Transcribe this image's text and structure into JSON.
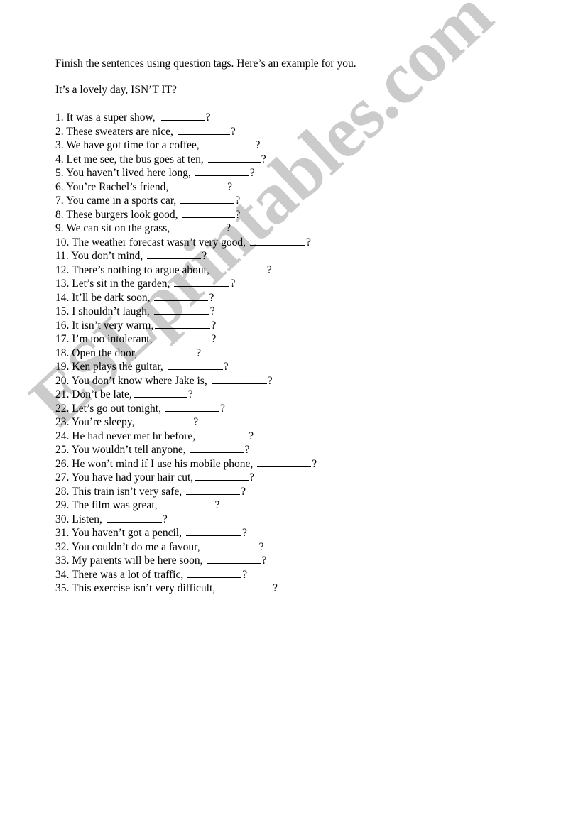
{
  "document": {
    "type": "worksheet",
    "intro": {
      "instruction": "Finish the sentences using question tags. Here’s an example for you.",
      "example": "It’s a lovely day, ISN’T IT?"
    },
    "watermark": {
      "text": "ESLprintables.com",
      "color": "#cbcbcb",
      "rotation_deg": -43
    },
    "question_mark": "?",
    "items": [
      {
        "num": "1.",
        "text": "It was a super show,",
        "gap": 6,
        "blank": 62,
        "tail": ""
      },
      {
        "num": "2.",
        "text": "These sweaters are nice,",
        "gap": 4,
        "blank": 74,
        "tail": ""
      },
      {
        "num": "3.",
        "text": "We have got time for a coffee,",
        "gap": 0,
        "blank": 76,
        "tail": ""
      },
      {
        "num": "4.",
        "text": "Let me see, the bus goes at ten,",
        "gap": 4,
        "blank": 74,
        "tail": ""
      },
      {
        "num": "5.",
        "text": "You haven’t lived here long,",
        "gap": 4,
        "blank": 76,
        "tail": ""
      },
      {
        "num": "6.",
        "text": "You’re Rachel’s friend,",
        "gap": 4,
        "blank": 76,
        "tail": ""
      },
      {
        "num": "7.",
        "text": "You came in a sports car,",
        "gap": 4,
        "blank": 76,
        "tail": ""
      },
      {
        "num": "8.",
        "text": "These burgers look good,",
        "gap": 4,
        "blank": 74,
        "tail": ""
      },
      {
        "num": "9.",
        "text": "We can sit on the grass,",
        "gap": 0,
        "blank": 76,
        "tail": ""
      },
      {
        "num": "10.",
        "text": "The weather forecast wasn’t very good,",
        "gap": 4,
        "blank": 78,
        "tail": ""
      },
      {
        "num": "11.",
        "text": "You don’t mind,",
        "gap": 4,
        "blank": 76,
        "tail": ""
      },
      {
        "num": "12.",
        "text": "There’s nothing to argue about,",
        "gap": 4,
        "blank": 74,
        "tail": ""
      },
      {
        "num": "13.",
        "text": "Let’s sit in the garden,",
        "gap": 4,
        "blank": 78,
        "tail": ""
      },
      {
        "num": "14.",
        "text": "It’ll be dark soon,",
        "gap": 4,
        "blank": 76,
        "tail": ""
      },
      {
        "num": "15.",
        "text": "I shouldn’t laugh,",
        "gap": 4,
        "blank": 78,
        "tail": ""
      },
      {
        "num": "16.",
        "text": "It isn’t very warm,",
        "gap": 0,
        "blank": 78,
        "tail": ""
      },
      {
        "num": "17.",
        "text": "I’m too intolerant,",
        "gap": 4,
        "blank": 76,
        "tail": ""
      },
      {
        "num": "18.",
        "text": "Open the door,",
        "gap": 4,
        "blank": 76,
        "tail": ""
      },
      {
        "num": "19.",
        "text": "Ken plays the guitar,",
        "gap": 4,
        "blank": 78,
        "tail": ""
      },
      {
        "num": "20.",
        "text": "You don’t know where Jake is,",
        "gap": 4,
        "blank": 78,
        "tail": ""
      },
      {
        "num": "21.",
        "text": "Don’t be late,",
        "gap": 0,
        "blank": 76,
        "tail": ""
      },
      {
        "num": "22.",
        "text": "Let’s go out tonight,",
        "gap": 4,
        "blank": 76,
        "tail": ""
      },
      {
        "num": "23.",
        "text": "You’re sleepy,",
        "gap": 4,
        "blank": 76,
        "tail": ""
      },
      {
        "num": "24.",
        "text": "He had never met hr before,",
        "gap": 0,
        "blank": 72,
        "tail": ""
      },
      {
        "num": "25.",
        "text": "You wouldn’t tell anyone,",
        "gap": 4,
        "blank": 76,
        "tail": ""
      },
      {
        "num": "26.",
        "text": "He won’t mind if I use his mobile phone,",
        "gap": 4,
        "blank": 76,
        "tail": ""
      },
      {
        "num": "27.",
        "text": "You have had your hair cut,",
        "gap": 0,
        "blank": 76,
        "tail": ""
      },
      {
        "num": "28.",
        "text": "This train isn’t very safe,",
        "gap": 4,
        "blank": 76,
        "tail": ""
      },
      {
        "num": "29.",
        "text": "The film was great,",
        "gap": 4,
        "blank": 74,
        "tail": ""
      },
      {
        "num": "30.",
        "text": "Listen,",
        "gap": 4,
        "blank": 78,
        "tail": ""
      },
      {
        "num": "31.",
        "text": "You haven’t got a pencil,",
        "gap": 4,
        "blank": 78,
        "tail": ""
      },
      {
        "num": "32.",
        "text": "You couldn’t do me a favour,",
        "gap": 4,
        "blank": 76,
        "tail": ""
      },
      {
        "num": "33.",
        "text": "My parents will be here soon,",
        "gap": 4,
        "blank": 76,
        "tail": ""
      },
      {
        "num": "34.",
        "text": "There was a lot of traffic,",
        "gap": 4,
        "blank": 76,
        "tail": ""
      },
      {
        "num": "35.",
        "text": "This exercise isn’t very difficult,",
        "gap": 0,
        "blank": 78,
        "tail": ""
      }
    ]
  }
}
